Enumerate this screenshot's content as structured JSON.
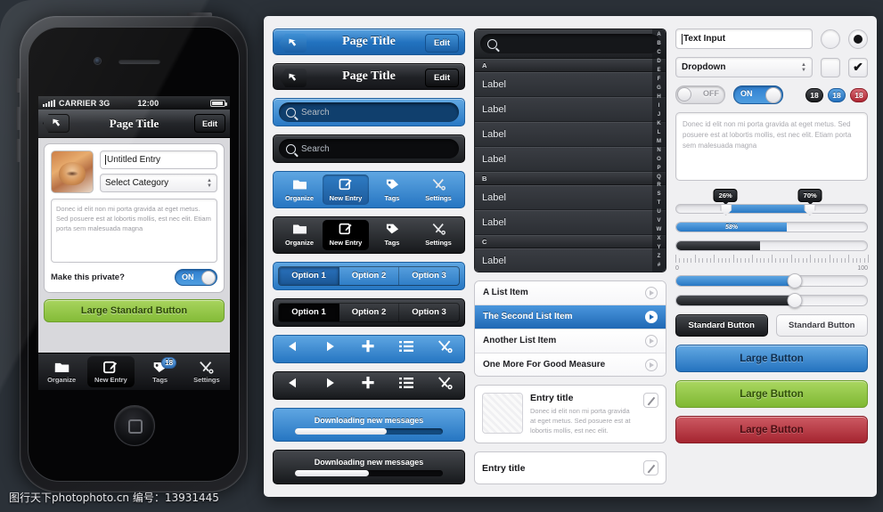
{
  "phone": {
    "status": {
      "carrier": "CARRIER 3G",
      "time": "12:00",
      "signal_icon": "signal-bars-icon",
      "battery_icon": "battery-icon"
    },
    "navbar": {
      "title": "Page Title",
      "back_icon": "back-arrow-icon",
      "edit": "Edit"
    },
    "form": {
      "title_value": "Untitled Entry",
      "category_value": "Select Category",
      "notes_text": "Donec id elit non mi porta gravida at eget metus. Sed posuere est at lobortis mollis, est nec elit. Etiam porta sem malesuada magna",
      "private_label": "Make this private?",
      "toggle_value": "ON",
      "primary_button": "Large Standard Button"
    },
    "tabbar": [
      {
        "label": "Organize",
        "icon": "folder-icon",
        "active": false
      },
      {
        "label": "New Entry",
        "icon": "compose-icon",
        "active": true
      },
      {
        "label": "Tags",
        "icon": "tag-icon",
        "active": false,
        "badge": "18"
      },
      {
        "label": "Settings",
        "icon": "tools-icon",
        "active": false
      }
    ]
  },
  "kit": {
    "navbars": [
      {
        "title": "Page Title",
        "edit": "Edit",
        "style": "blue"
      },
      {
        "title": "Page Title",
        "edit": "Edit",
        "style": "dark"
      }
    ],
    "searchbars": [
      {
        "placeholder": "Search",
        "style": "blue"
      },
      {
        "placeholder": "Search",
        "style": "dark"
      }
    ],
    "tabbars": [
      {
        "style": "blue",
        "items": [
          {
            "label": "Organize",
            "icon": "folder-icon",
            "active": false
          },
          {
            "label": "New Entry",
            "icon": "compose-icon",
            "active": true
          },
          {
            "label": "Tags",
            "icon": "tag-icon",
            "active": false
          },
          {
            "label": "Settings",
            "icon": "tools-icon",
            "active": false
          }
        ]
      },
      {
        "style": "dark",
        "items": [
          {
            "label": "Organize",
            "icon": "folder-icon",
            "active": false
          },
          {
            "label": "New Entry",
            "icon": "compose-icon",
            "active": true
          },
          {
            "label": "Tags",
            "icon": "tag-icon",
            "active": false
          },
          {
            "label": "Settings",
            "icon": "tools-icon",
            "active": false
          }
        ]
      }
    ],
    "segments": [
      {
        "style": "blue",
        "options": [
          "Option 1",
          "Option 2",
          "Option 3"
        ],
        "selected": 0
      },
      {
        "style": "dark",
        "options": [
          "Option 1",
          "Option 2",
          "Option 3"
        ],
        "selected": 0
      }
    ],
    "iconbars": [
      {
        "style": "blue",
        "icons": [
          "prev-icon",
          "next-icon",
          "plus-icon",
          "list-icon",
          "tools-icon"
        ]
      },
      {
        "style": "dark",
        "icons": [
          "prev-icon",
          "next-icon",
          "plus-icon",
          "list-icon",
          "tools-icon"
        ]
      }
    ],
    "progress_bars": [
      {
        "style": "blue",
        "label": "Downloading new messages",
        "percent": 62
      },
      {
        "style": "dark",
        "label": "Downloading new messages",
        "percent": 50
      }
    ]
  },
  "indexed_list": {
    "search_placeholder": "",
    "search_icon": "search-icon",
    "sections": [
      {
        "header": "A",
        "rows": [
          "Label",
          "Label",
          "Label",
          "Label"
        ]
      },
      {
        "header": "B",
        "rows": [
          "Label",
          "Label"
        ]
      },
      {
        "header": "C",
        "rows": [
          "Label"
        ]
      }
    ],
    "index_letters": [
      "A",
      "B",
      "C",
      "D",
      "E",
      "F",
      "G",
      "H",
      "I",
      "J",
      "K",
      "L",
      "M",
      "N",
      "O",
      "P",
      "Q",
      "R",
      "S",
      "T",
      "U",
      "V",
      "W",
      "X",
      "Y",
      "Z",
      "#"
    ]
  },
  "plain_list": {
    "rows": [
      {
        "label": "A List Item",
        "selected": false,
        "accessory": "chevron-circle-icon"
      },
      {
        "label": "The Second List Item",
        "selected": true,
        "accessory": "chevron-circle-icon"
      },
      {
        "label": "Another List Item",
        "selected": false,
        "accessory": "chevron-circle-icon"
      },
      {
        "label": "One More For Good Measure",
        "selected": false,
        "accessory": "chevron-circle-icon"
      }
    ]
  },
  "entry_cards": [
    {
      "title": "Entry title",
      "description": "Donec id elit non mi porta gravida at eget metus. Sed posuere est at lobortis mollis, est nec elit.",
      "edit_icon": "pencil-icon",
      "has_thumb": true
    },
    {
      "title": "Entry title",
      "description": "",
      "edit_icon": "pencil-icon",
      "has_thumb": false
    }
  ],
  "controls": {
    "text_input": {
      "value": "Text Input"
    },
    "dropdown": {
      "value": "Dropdown",
      "stepper_icon": "stepper-arrows-icon"
    },
    "radio_off": {
      "state": "off"
    },
    "radio_on": {
      "state": "on"
    },
    "checkbox_off": {
      "state": "off",
      "mark": ""
    },
    "checkbox_on": {
      "state": "on",
      "mark": "✔"
    },
    "switch_off": {
      "label": "OFF"
    },
    "switch_on": {
      "label": "ON"
    },
    "badges": [
      {
        "value": "18",
        "color": "#1a1c1f",
        "style": "dark"
      },
      {
        "value": "18",
        "color": "#2470bd",
        "style": "blue"
      },
      {
        "value": "18",
        "color": "#ad2733",
        "style": "red"
      }
    ],
    "textarea": {
      "value": "Donec id elit non mi porta gravida at eget metus. Sed posuere est at lobortis mollis, est nec elit. Etiam porta sem malesuada magna"
    },
    "range_slider": {
      "min_label": "26%",
      "max_label": "70%",
      "min": 26,
      "max": 70
    },
    "progress_blue": {
      "label": "58%",
      "percent": 58
    },
    "progress_dark": {
      "percent": 44
    },
    "ruler": {
      "start_label": "0",
      "end_label": "100",
      "min": 0,
      "max": 100
    },
    "slider_blue": {
      "percent": 62
    },
    "slider_dark": {
      "percent": 62
    },
    "standard_buttons": [
      {
        "label": "Standard Button",
        "style": "dark"
      },
      {
        "label": "Standard Button",
        "style": "light"
      }
    ],
    "large_buttons": [
      {
        "label": "Large Button",
        "style": "blue",
        "color": "#2573bf"
      },
      {
        "label": "Large Button",
        "style": "green",
        "color": "#7fb833"
      },
      {
        "label": "Large Button",
        "style": "red",
        "color": "#a52530"
      }
    ]
  },
  "watermark": {
    "text": "图行天下photophoto.cn  编号：13931445"
  }
}
